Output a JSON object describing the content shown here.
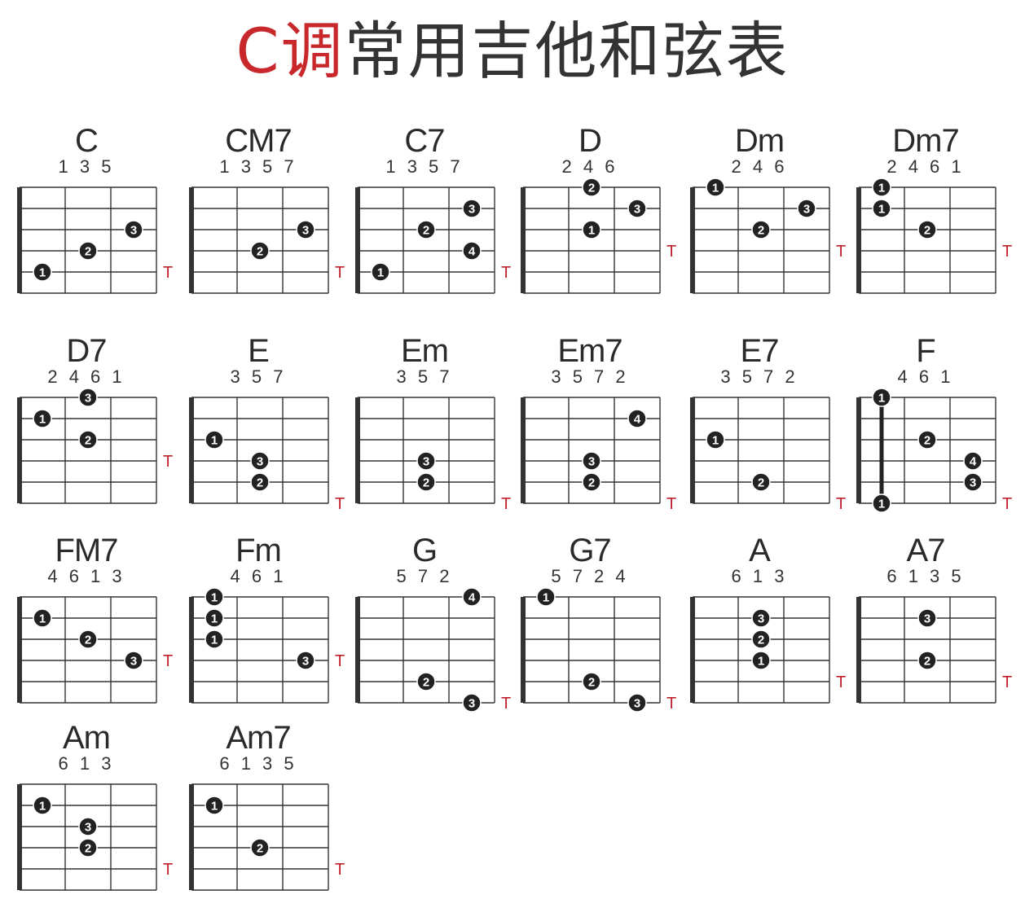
{
  "page": {
    "title_red": "C调",
    "title_rest": "常用吉他和弦表",
    "tonic_marker": "T",
    "colors": {
      "title_red": "#c8282c",
      "title_text": "#333333",
      "tonic_marker": "#c0202c",
      "finger_dot": "#222222",
      "grid": "#333333"
    }
  },
  "chords": [
    {
      "name": "C",
      "notes": "1 3 5",
      "fingers": [
        {
          "string": 5,
          "fret": 1,
          "finger": "1"
        },
        {
          "string": 4,
          "fret": 2,
          "finger": "2"
        },
        {
          "string": 3,
          "fret": 3,
          "finger": "3"
        }
      ],
      "tonic_string": 5
    },
    {
      "name": "CM7",
      "notes": "1 3 5 7",
      "fingers": [
        {
          "string": 4,
          "fret": 2,
          "finger": "2"
        },
        {
          "string": 3,
          "fret": 3,
          "finger": "3"
        }
      ],
      "tonic_string": 5
    },
    {
      "name": "C7",
      "notes": "1 3 5 7",
      "fingers": [
        {
          "string": 5,
          "fret": 1,
          "finger": "1"
        },
        {
          "string": 4,
          "fret": 3,
          "finger": "4"
        },
        {
          "string": 3,
          "fret": 2,
          "finger": "2"
        },
        {
          "string": 2,
          "fret": 3,
          "finger": "3"
        }
      ],
      "tonic_string": 5
    },
    {
      "name": "D",
      "notes": "2 4 6",
      "fingers": [
        {
          "string": 1,
          "fret": 2,
          "finger": "2"
        },
        {
          "string": 2,
          "fret": 3,
          "finger": "3"
        },
        {
          "string": 3,
          "fret": 2,
          "finger": "1"
        }
      ],
      "tonic_string": 4
    },
    {
      "name": "Dm",
      "notes": "2 4 6",
      "fingers": [
        {
          "string": 1,
          "fret": 1,
          "finger": "1"
        },
        {
          "string": 2,
          "fret": 3,
          "finger": "3"
        },
        {
          "string": 3,
          "fret": 2,
          "finger": "2"
        }
      ],
      "tonic_string": 4
    },
    {
      "name": "Dm7",
      "notes": "2 4 6 1",
      "fingers": [
        {
          "string": 1,
          "fret": 1,
          "finger": "1"
        },
        {
          "string": 2,
          "fret": 1,
          "finger": "1"
        },
        {
          "string": 3,
          "fret": 2,
          "finger": "2"
        }
      ],
      "tonic_string": 4
    },
    {
      "name": "D7",
      "notes": "2 4 6 1",
      "fingers": [
        {
          "string": 1,
          "fret": 2,
          "finger": "3"
        },
        {
          "string": 2,
          "fret": 1,
          "finger": "1"
        },
        {
          "string": 3,
          "fret": 2,
          "finger": "2"
        }
      ],
      "tonic_string": 4
    },
    {
      "name": "E",
      "notes": "3 5 7",
      "fingers": [
        {
          "string": 3,
          "fret": 1,
          "finger": "1"
        },
        {
          "string": 4,
          "fret": 2,
          "finger": "3"
        },
        {
          "string": 5,
          "fret": 2,
          "finger": "2"
        }
      ],
      "tonic_string": 6
    },
    {
      "name": "Em",
      "notes": "3 5 7",
      "fingers": [
        {
          "string": 4,
          "fret": 2,
          "finger": "3"
        },
        {
          "string": 5,
          "fret": 2,
          "finger": "2"
        }
      ],
      "tonic_string": 6
    },
    {
      "name": "Em7",
      "notes": "3 5 7 2",
      "fingers": [
        {
          "string": 2,
          "fret": 3,
          "finger": "4"
        },
        {
          "string": 4,
          "fret": 2,
          "finger": "3"
        },
        {
          "string": 5,
          "fret": 2,
          "finger": "2"
        }
      ],
      "tonic_string": 6
    },
    {
      "name": "E7",
      "notes": "3 5 7 2",
      "fingers": [
        {
          "string": 3,
          "fret": 1,
          "finger": "1"
        },
        {
          "string": 5,
          "fret": 2,
          "finger": "2"
        }
      ],
      "tonic_string": 6
    },
    {
      "name": "F",
      "notes": "4 6 1",
      "fingers": [
        {
          "string": 1,
          "fret": 1,
          "finger": "1"
        },
        {
          "string": 3,
          "fret": 2,
          "finger": "2"
        },
        {
          "string": 4,
          "fret": 3,
          "finger": "4"
        },
        {
          "string": 5,
          "fret": 3,
          "finger": "3"
        },
        {
          "string": 6,
          "fret": 1,
          "finger": "1"
        }
      ],
      "barre_fret": 1,
      "tonic_string": 6
    },
    {
      "name": "FM7",
      "notes": "4 6 1 3",
      "fingers": [
        {
          "string": 2,
          "fret": 1,
          "finger": "1"
        },
        {
          "string": 3,
          "fret": 2,
          "finger": "2"
        },
        {
          "string": 4,
          "fret": 3,
          "finger": "3"
        }
      ],
      "tonic_string": 4
    },
    {
      "name": "Fm",
      "notes": "4 6 1",
      "fingers": [
        {
          "string": 1,
          "fret": 1,
          "finger": "1"
        },
        {
          "string": 2,
          "fret": 1,
          "finger": "1"
        },
        {
          "string": 3,
          "fret": 1,
          "finger": "1"
        },
        {
          "string": 4,
          "fret": 3,
          "finger": "3"
        }
      ],
      "tonic_string": 4
    },
    {
      "name": "G",
      "notes": "5 7 2",
      "fingers": [
        {
          "string": 1,
          "fret": 3,
          "finger": "4"
        },
        {
          "string": 5,
          "fret": 2,
          "finger": "2"
        },
        {
          "string": 6,
          "fret": 3,
          "finger": "3"
        }
      ],
      "tonic_string": 6
    },
    {
      "name": "G7",
      "notes": "5 7 2 4",
      "fingers": [
        {
          "string": 1,
          "fret": 1,
          "finger": "1"
        },
        {
          "string": 5,
          "fret": 2,
          "finger": "2"
        },
        {
          "string": 6,
          "fret": 3,
          "finger": "3"
        }
      ],
      "tonic_string": 6
    },
    {
      "name": "A",
      "notes": "6 1 3",
      "fingers": [
        {
          "string": 2,
          "fret": 2,
          "finger": "3"
        },
        {
          "string": 3,
          "fret": 2,
          "finger": "2"
        },
        {
          "string": 4,
          "fret": 2,
          "finger": "1"
        }
      ],
      "tonic_string": 5
    },
    {
      "name": "A7",
      "notes": "6 1 3 5",
      "fingers": [
        {
          "string": 2,
          "fret": 2,
          "finger": "3"
        },
        {
          "string": 4,
          "fret": 2,
          "finger": "2"
        }
      ],
      "tonic_string": 5
    },
    {
      "name": "Am",
      "notes": "6 1 3",
      "fingers": [
        {
          "string": 2,
          "fret": 1,
          "finger": "1"
        },
        {
          "string": 3,
          "fret": 2,
          "finger": "3"
        },
        {
          "string": 4,
          "fret": 2,
          "finger": "2"
        }
      ],
      "tonic_string": 5
    },
    {
      "name": "Am7",
      "notes": "6 1 3 5",
      "fingers": [
        {
          "string": 2,
          "fret": 1,
          "finger": "1"
        },
        {
          "string": 4,
          "fret": 2,
          "finger": "2"
        }
      ],
      "tonic_string": 5
    }
  ]
}
